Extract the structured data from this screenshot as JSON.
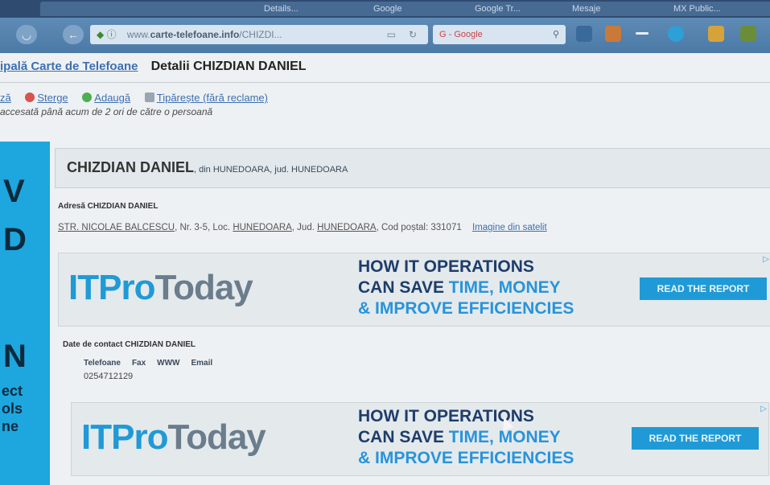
{
  "browser": {
    "tabs": [
      "",
      "",
      "Details...",
      "Google",
      "Google Tr...",
      "Mesaje",
      "MX Public..."
    ],
    "url_prefix": "www.",
    "url_host": "carte-telefoane.info",
    "url_path": "/CHIZDI...",
    "search_placeholder": "G - Google"
  },
  "page": {
    "breadcrumb_link": "ipală Carte de Telefoane",
    "title": "Detalii CHIZDIAN DANIEL",
    "actions": {
      "edit": "ză",
      "delete": "Sterge",
      "add": "Adaugă",
      "print": "Tipărește (fără reclame)"
    },
    "access_note": "accesată până acum de 2 ori de către o persoană",
    "left_banner_text": [
      "V",
      "D",
      "N",
      "ect",
      "ols",
      "ne"
    ],
    "person_name": "CHIZDIAN DANIEL",
    "person_location": ", din HUNEDOARA, jud. HUNEDOARA",
    "address_title": "Adresă CHIZDIAN DANIEL",
    "address": {
      "street": "STR. NICOLAE BALCESCU",
      "number": ", Nr. 3-5, Loc. ",
      "locality": "HUNEDOARA",
      "county_prefix": ", Jud. ",
      "county": "HUNEDOARA",
      "postal": ", Cod poștal: 331071",
      "satellite_link": "Imagine din satelit"
    },
    "contact_title": "Date de contact CHIZDIAN DANIEL",
    "contact_headers": [
      "Telefoane",
      "Fax",
      "WWW",
      "Email"
    ],
    "phone": "0254712129"
  },
  "ads": [
    {
      "logo_a": "ITPro",
      "logo_b": "Today",
      "line1": "HOW IT OPERATIONS",
      "line2_a": "CAN SAVE ",
      "line2_b": "TIME, MONEY",
      "line3": "& IMPROVE EFFICIENCIES",
      "cta": "READ THE REPORT"
    },
    {
      "logo_a": "ITPro",
      "logo_b": "Today",
      "line1": "HOW IT OPERATIONS",
      "line2_a": "CAN SAVE ",
      "line2_b": "TIME, MONEY",
      "line3": "& IMPROVE EFFICIENCIES",
      "cta": "READ THE REPORT"
    }
  ],
  "colors": {
    "link": "#3d6fb0",
    "ad_blue": "#1f9ad6",
    "ad_navy": "#1d3d6b"
  }
}
